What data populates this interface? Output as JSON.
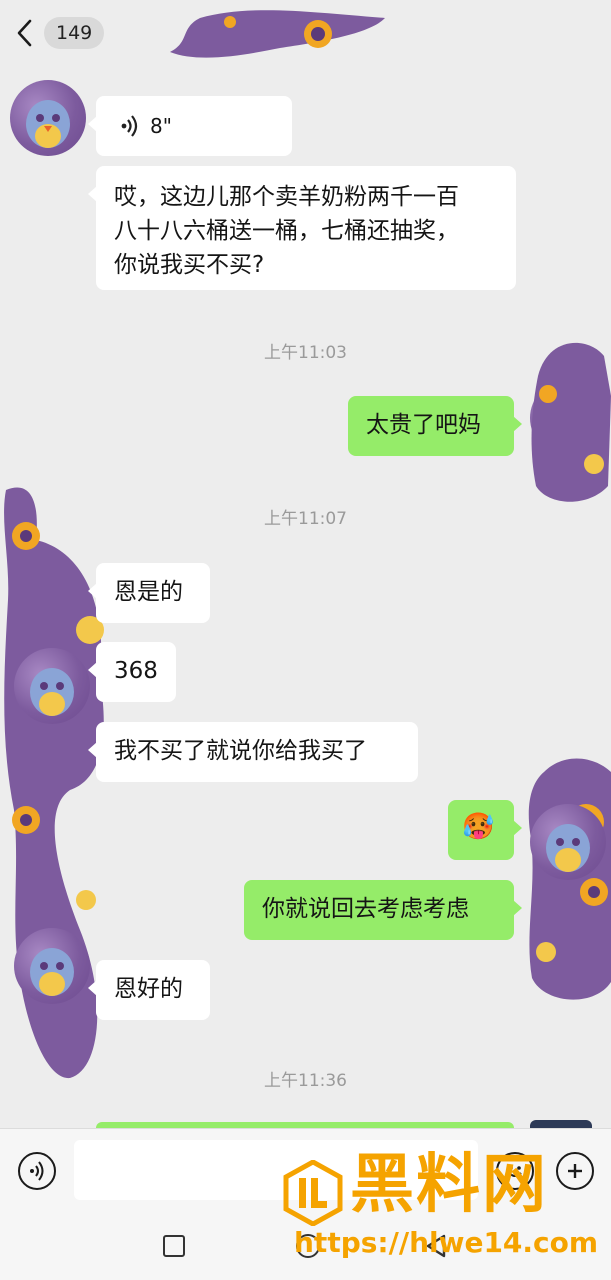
{
  "header": {
    "unread_count": "149"
  },
  "messages": {
    "voice_duration": "8\"",
    "m1_line1": "哎，这边儿那个卖羊奶粉两千一百",
    "m1_line2": "八十八六桶送一桶，七桶还抽奖，",
    "m1_line3": "你说我买不买?",
    "t1": "上午11:03",
    "m2": "太贵了吧妈",
    "t2": "上午11:07",
    "m3": "恩是的",
    "m4": "368",
    "m5": "我不买了就说你给我买了",
    "m6_emoji": "🥵",
    "m7": "你就说回去考虑考虑",
    "m8": "恩好的",
    "t3": "上午11:36"
  },
  "watermark": {
    "title": "黑料网",
    "url": "https://hlwe14.com"
  },
  "colors": {
    "background": "#ededed",
    "my_bubble": "#95ec69",
    "other_bubble": "#ffffff",
    "watermark": "#f5a300",
    "avatar_purple": "#7d5b9e"
  }
}
